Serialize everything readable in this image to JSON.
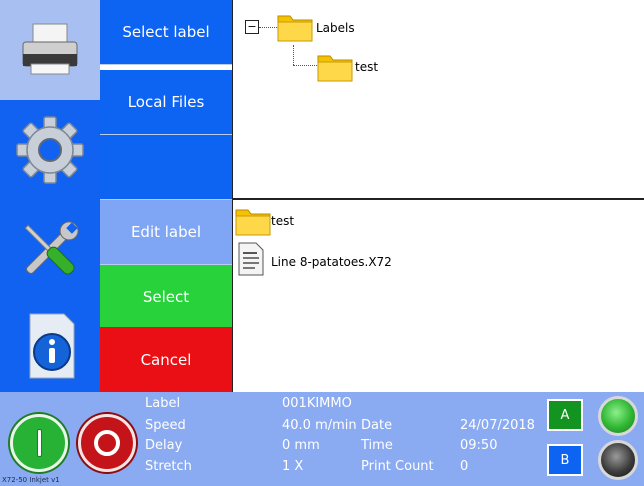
{
  "menu": {
    "select_label": "Select label",
    "local_files": "Local Files",
    "blank": "",
    "edit_label": "Edit label",
    "select": "Select",
    "cancel": "Cancel"
  },
  "colors": {
    "menu_blue": "#0d63f2",
    "menu_light": "#7fa6f4",
    "select_green": "#28d23a",
    "cancel_red": "#ea0f14"
  },
  "tree": {
    "root_label": "Labels",
    "child_label": "test",
    "expand_symbol": "−"
  },
  "files": [
    {
      "name": "test",
      "icon": "folder-icon"
    },
    {
      "name": "Line 8-patatoes.X72",
      "icon": "document-icon"
    }
  ],
  "status": {
    "label_key": "Label",
    "label_val": "001KIMMO",
    "speed_key": "Speed",
    "speed_val": "40.0 m/min",
    "date_key": "Date",
    "date_val": "24/07/2018",
    "delay_key": "Delay",
    "delay_val": "0 mm",
    "time_key": "Time",
    "time_val": "09:50",
    "stretch_key": "Stretch",
    "stretch_val": "1 X",
    "count_key": "Print Count",
    "count_val": "0"
  },
  "channels": {
    "a_label": "A",
    "b_label": "B"
  },
  "footer": {
    "model": "X72-50 Inkjet v1"
  }
}
